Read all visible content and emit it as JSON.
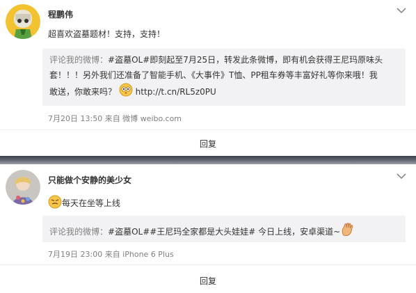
{
  "posts": [
    {
      "author": "程鹏伟",
      "text": "超喜欢盗墓题材！支持，支持！",
      "quote_prefix": "评论我的微博：",
      "quote_text_1": "#盗墓OL#即刻起至7月25日，转发此条微博，即有机会获得王尼玛原味头",
      "quote_text_2": "套！！！另外我们还准备了智能手机、《大事件》T恤、PP租车券等丰富好礼等你来哦！我",
      "quote_text_3": "敢送，你敢来吗？",
      "quote_link": "http://t.cn/RL5z0PU",
      "meta": "7月20日 13:50 来自 微博 weibo.com",
      "reply_label": "回复"
    },
    {
      "author": "只能做个安静的美少女",
      "text": "每天在坐等上线",
      "quote_prefix": "评论我的微博：",
      "quote_text": "#盗墓OL##王尼玛全家都是大头娃娃# 今日上线，安卓渠道~",
      "meta": "7月19日 23:00 来自 iPhone 6 Plus",
      "reply_label": "回复"
    }
  ],
  "icons": {
    "caret": "chevron-down-icon",
    "emoji_eyes": "wide-eyes-emoji-icon",
    "emoji_wave": "waving-hand-emoji-icon",
    "emoji_face": "annoyed-face-emoji-icon"
  },
  "colors": {
    "quote_bg": "#f2f2f5",
    "meta_text": "#808080",
    "body_text": "#333333"
  }
}
